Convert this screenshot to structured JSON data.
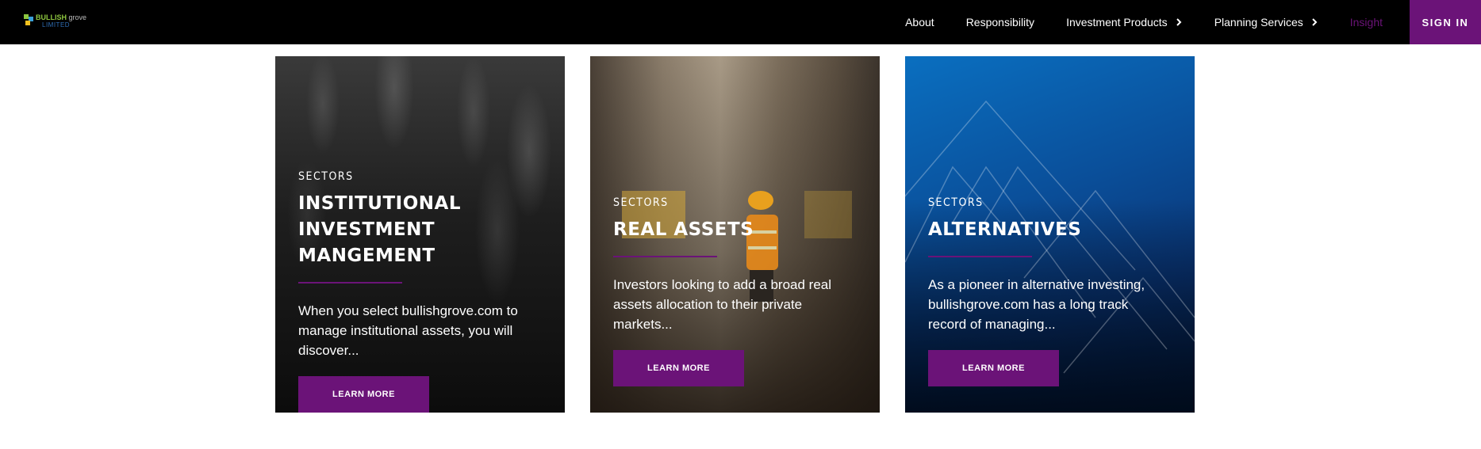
{
  "header": {
    "logo": {
      "word1": "BULLISH",
      "word2": " grove",
      "word3": "LIMITED"
    },
    "nav": [
      {
        "label": "About",
        "has_dropdown": false
      },
      {
        "label": "Responsibility",
        "has_dropdown": false
      },
      {
        "label": "Investment Products",
        "has_dropdown": true
      },
      {
        "label": "Planning Services",
        "has_dropdown": true
      },
      {
        "label": "Insight",
        "has_dropdown": false
      }
    ],
    "signin_label": "SIGN IN"
  },
  "cards": [
    {
      "eyebrow": "SECTORS",
      "title": "INSTITUTIONAL INVESTMENT MANGEMENT",
      "description": "When you select bullishgrove.com to manage institutional assets, you will discover...",
      "button": "LEARN MORE"
    },
    {
      "eyebrow": "SECTORS",
      "title": "REAL ASSETS",
      "description": "Investors looking to add a broad real assets allocation to their private markets...",
      "button": "LEARN MORE"
    },
    {
      "eyebrow": "SECTORS",
      "title": "ALTERNATIVES",
      "description": "As a pioneer in alternative investing, bullishgrove.com has a long track record of managing...",
      "button": "LEARN MORE"
    }
  ],
  "colors": {
    "brand_purple": "#6b1378",
    "header_bg": "#000000",
    "text_light": "#ffffff"
  },
  "icons": {
    "dropdown": "chevron-right-icon"
  }
}
